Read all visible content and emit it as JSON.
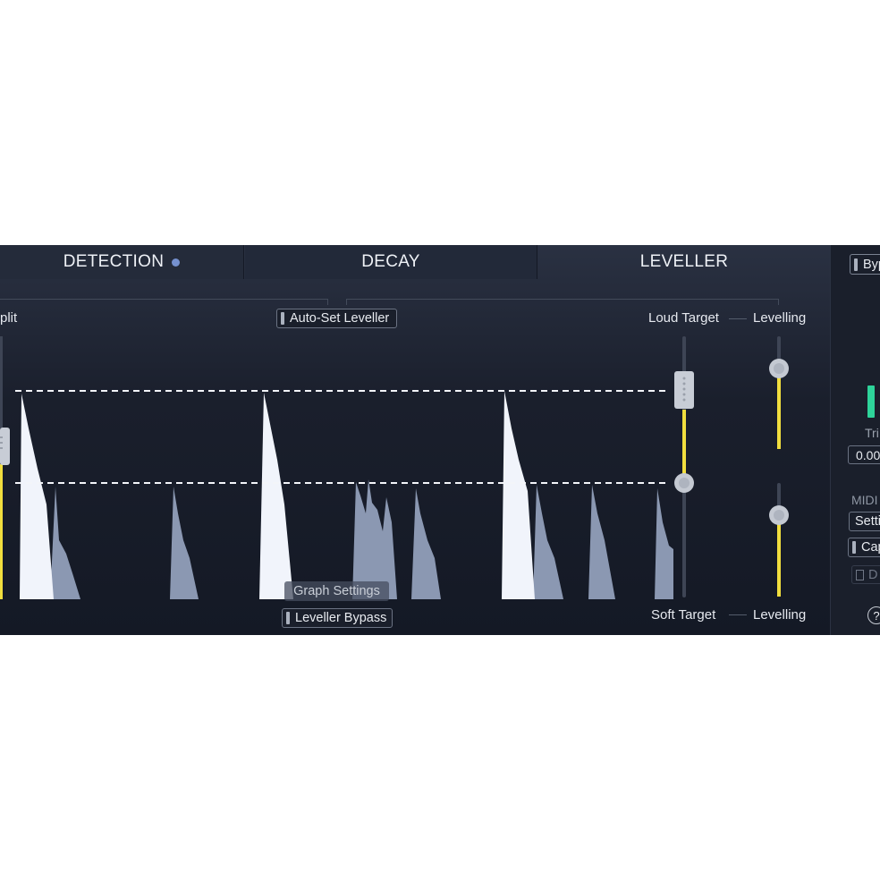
{
  "tabs": {
    "detection": "DETECTION",
    "decay": "DECAY",
    "leveller": "LEVELLER"
  },
  "leveller": {
    "split_label": "plit",
    "auto_set_label": "Auto-Set Leveller",
    "loud_target_label": "Loud Target",
    "levelling_top_label": "Levelling",
    "soft_target_label": "Soft Target",
    "levelling_bottom_label": "Levelling",
    "graph_settings_label": "Graph Settings",
    "bypass_label": "Leveller Bypass"
  },
  "sidebar": {
    "bypass_label": "Byp",
    "trim_label": "Tri",
    "trim_value": "0.00",
    "midi_label": "MIDI",
    "settings_label": "Setti",
    "capture_label": "Cap",
    "doc_label": "D",
    "help_label": "?"
  },
  "colors": {
    "panel_bg": "#1a1f2b",
    "active_tab": "#2a3142",
    "accent_yellow": "#f1de3e",
    "meter_green": "#2ed39a",
    "waveform_bright": "#f1f4fb",
    "waveform_dim": "#8b98b2",
    "active_dot": "#7591cf"
  }
}
